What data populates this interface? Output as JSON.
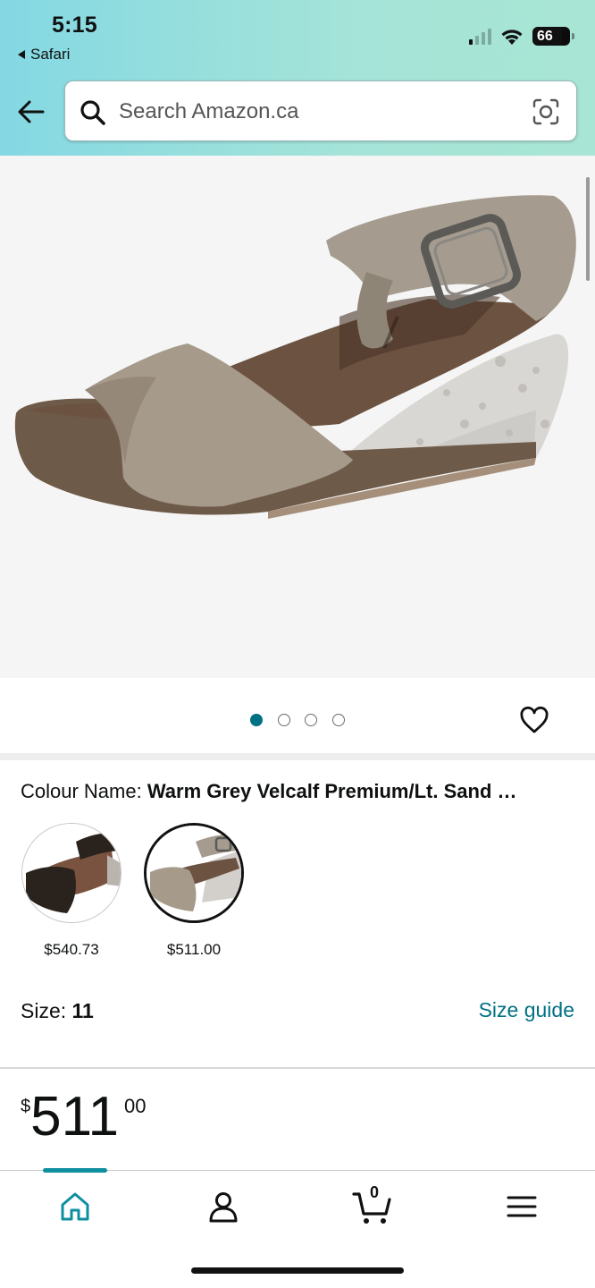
{
  "status_bar": {
    "time": "5:15",
    "back_app": "Safari",
    "battery": "66"
  },
  "search": {
    "placeholder": "Search Amazon.ca"
  },
  "gallery": {
    "dot_count": 4,
    "active_index": 0
  },
  "colour": {
    "label": "Colour Name: ",
    "value": "Warm Grey Velcalf Premium/Lt. Sand …",
    "options": [
      {
        "price": "$540.73"
      },
      {
        "price": "$511.00"
      }
    ]
  },
  "size": {
    "label": "Size: ",
    "value": "11",
    "guide_label": "Size guide"
  },
  "price": {
    "currency": "$",
    "whole": "511",
    "fraction": "00"
  },
  "bottom_nav": {
    "cart_count": "0"
  },
  "colors": {
    "accent": "#007185",
    "nav_indicator": "#0f8fa0",
    "header_gradient_start": "#84d8e3",
    "header_gradient_end": "#a8e5d4"
  }
}
